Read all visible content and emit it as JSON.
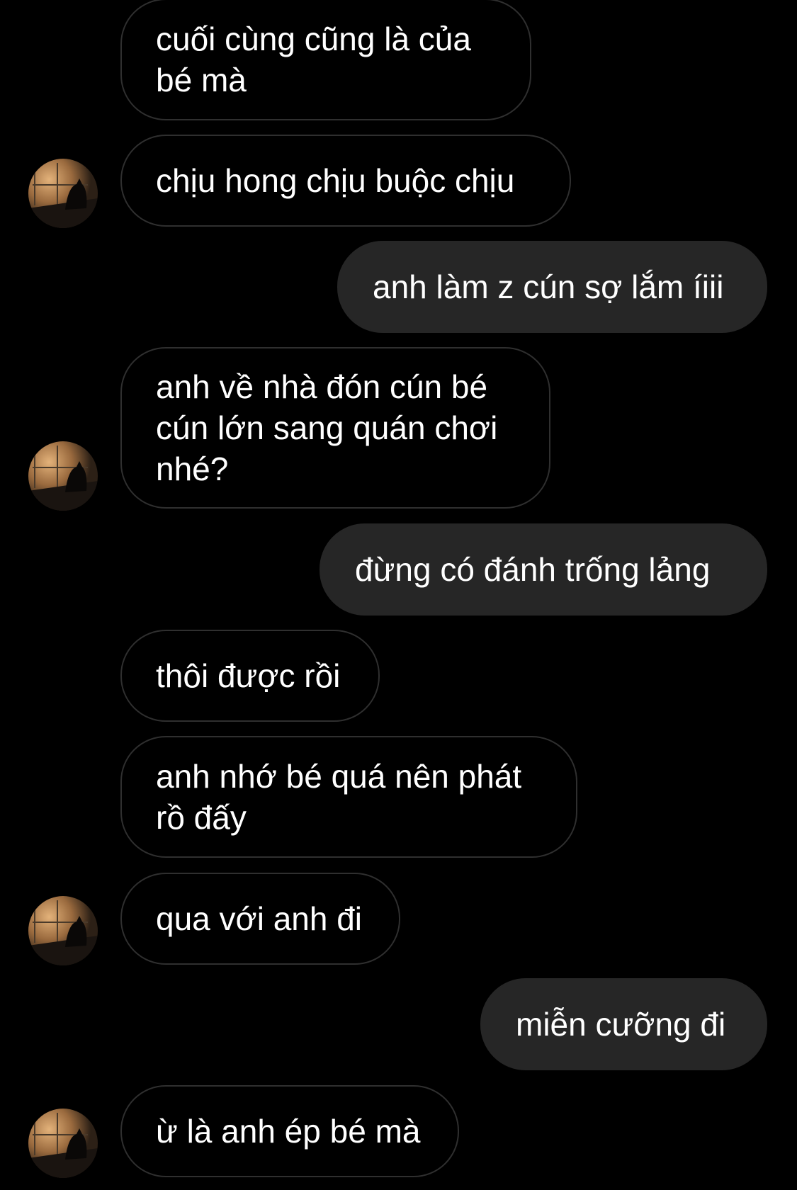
{
  "colors": {
    "background": "#000000",
    "incoming_bubble_border": "#2f2f2f",
    "outgoing_bubble_fill": "#262626",
    "text": "#ffffff"
  },
  "messages": [
    {
      "direction": "incoming",
      "text": "cuối cùng cũng là của\nbé mà",
      "avatar": false
    },
    {
      "direction": "incoming",
      "text": "chịu hong chịu buộc chịu",
      "avatar": true
    },
    {
      "direction": "outgoing",
      "text": "anh làm z cún sợ lắm íiii"
    },
    {
      "direction": "incoming",
      "text": "anh về nhà đón cún bé\ncún lớn sang quán chơi\nnhé?",
      "avatar": true
    },
    {
      "direction": "outgoing",
      "text": "đừng có đánh trống lảng"
    },
    {
      "direction": "incoming",
      "text": "thôi được rồi",
      "avatar": false
    },
    {
      "direction": "incoming",
      "text": "anh nhớ bé quá nên phát\nrồ đấy",
      "avatar": false
    },
    {
      "direction": "incoming",
      "text": "qua với anh đi",
      "avatar": true
    },
    {
      "direction": "outgoing",
      "text": "miễn cưỡng đi"
    },
    {
      "direction": "incoming",
      "text": "ừ là anh ép bé mà",
      "avatar": true
    }
  ],
  "avatar_icon": "contact-avatar-photo-icon"
}
